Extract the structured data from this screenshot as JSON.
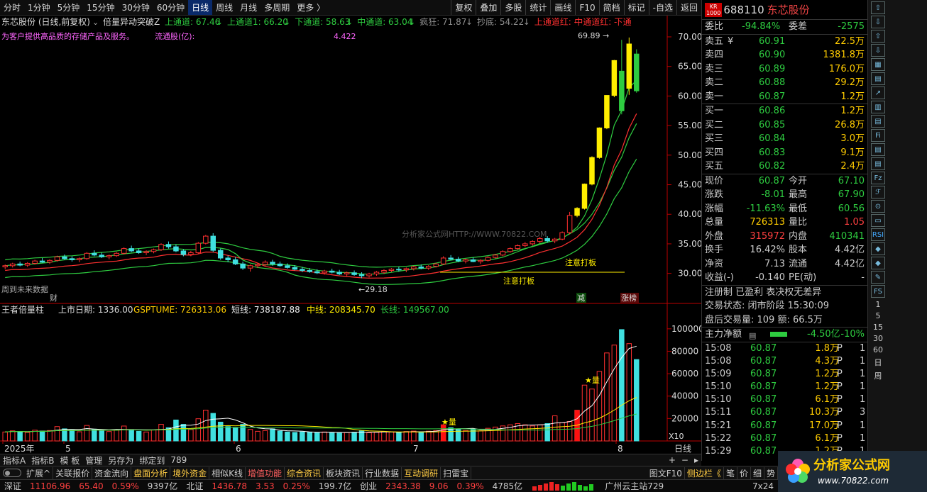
{
  "toolbar": {
    "periods": [
      "分时",
      "1分钟",
      "5分钟",
      "15分钟",
      "30分钟",
      "60分钟",
      "日线",
      "周线",
      "月线",
      "多周期",
      "更多 〉"
    ],
    "active": "日线",
    "right": [
      "复权",
      "叠加",
      "多股",
      "统计",
      "画线",
      "F10",
      "简档",
      "标记",
      "-自选",
      "返回"
    ]
  },
  "chart": {
    "stock_label": "东芯股份 (日线,前复权)",
    "indicator_label": "倍量异动突破Z",
    "indicator_values": [
      {
        "text": "上通道: 67.46",
        "arrow": "↓",
        "color": "#2ecc40"
      },
      {
        "text": "上通道1: 66.20",
        "arrow": "↓",
        "color": "#2ecc40"
      },
      {
        "text": "下通道: 58.63",
        "arrow": "↓",
        "color": "#2ecc40"
      },
      {
        "text": "中通道: 63.04",
        "arrow": "↓",
        "color": "#2ecc40"
      },
      {
        "text": "疯狂: 71.87",
        "arrow": "↓",
        "color": "#909090"
      },
      {
        "text": "抄底: 54.22",
        "arrow": "↓",
        "color": "#909090"
      },
      {
        "text": "上通道红: -",
        "arrow": "",
        "color": "#ff3030"
      },
      {
        "text": "中通道红: -",
        "arrow": "",
        "color": "#ff3030"
      },
      {
        "text": "下通",
        "arrow": "",
        "color": "#ff3030"
      }
    ],
    "business_text": "为客户提供高品质的存储产品及服务。",
    "float_share_label": "流通股(亿):",
    "float_share_value": "4.422",
    "watermark": "分析家公式网HTTP://WWW.70822.COM",
    "future_label": "周到未来数据",
    "cai_label": "财",
    "annot_warn1": "注意打板",
    "annot_warn2": "注意打板",
    "low_mark": "←29.18",
    "high_mark": "69.89 →",
    "tag_jian": "减",
    "tag_zhangbang": "涨榜",
    "vol_title": "王者倍量柱",
    "vol_listed": "上市日期: 1336.00",
    "vol_gsp": "GSPTUME: 726313.06",
    "vol_short": "短线: 738187.88",
    "vol_mid": "中线: 208345.70",
    "vol_long": "长线: 149567.00",
    "vol_star": "★量",
    "vol_x10": "X10",
    "period_label": "日线"
  },
  "chart_data": [
    {
      "type": "candlestick",
      "title": "东芯股份 (日线,前复权)",
      "y_ticks": [
        "70.00",
        "65.00",
        "60.00",
        "55.00",
        "50.00",
        "45.00",
        "40.00",
        "35.00",
        "30.00"
      ],
      "ylim": [
        28.4,
        71.2
      ],
      "x_labels": [
        "2025年",
        "5",
        "6",
        "7",
        "8"
      ],
      "ohlc": [
        [
          31.1,
          31.5,
          30.7,
          31.3
        ],
        [
          31.3,
          31.8,
          31.0,
          31.6
        ],
        [
          31.6,
          32.0,
          31.2,
          31.4
        ],
        [
          31.4,
          31.9,
          31.1,
          31.7
        ],
        [
          31.7,
          32.3,
          31.5,
          32.1
        ],
        [
          32.1,
          32.6,
          31.8,
          31.9
        ],
        [
          31.9,
          32.4,
          31.6,
          32.2
        ],
        [
          32.2,
          33.0,
          32.0,
          32.8
        ],
        [
          32.8,
          33.2,
          32.3,
          32.5
        ],
        [
          32.5,
          32.9,
          32.0,
          32.3
        ],
        [
          32.3,
          32.7,
          31.9,
          32.5
        ],
        [
          32.5,
          33.6,
          32.3,
          33.4
        ],
        [
          33.4,
          33.9,
          32.9,
          33.1
        ],
        [
          33.1,
          33.5,
          32.6,
          32.8
        ],
        [
          32.8,
          33.2,
          32.4,
          33.0
        ],
        [
          33.0,
          33.6,
          32.8,
          33.4
        ],
        [
          33.4,
          34.4,
          33.2,
          34.2
        ],
        [
          34.2,
          34.7,
          33.6,
          33.8
        ],
        [
          33.8,
          34.2,
          33.3,
          33.5
        ],
        [
          33.5,
          33.9,
          33.1,
          33.7
        ],
        [
          33.7,
          34.2,
          33.4,
          34.0
        ],
        [
          34.0,
          35.1,
          33.8,
          34.9
        ],
        [
          34.9,
          35.4,
          34.2,
          34.5
        ],
        [
          34.5,
          34.9,
          33.6,
          33.8
        ],
        [
          33.8,
          34.1,
          32.9,
          33.2
        ],
        [
          33.2,
          33.8,
          32.9,
          33.5
        ],
        [
          33.5,
          35.3,
          33.3,
          35.1
        ],
        [
          35.1,
          36.5,
          34.9,
          36.3
        ],
        [
          36.3,
          36.8,
          33.6,
          33.9
        ],
        [
          33.9,
          34.2,
          32.3,
          32.6
        ],
        [
          32.6,
          33.0,
          31.9,
          32.3
        ],
        [
          32.3,
          32.8,
          31.4,
          31.6
        ],
        [
          31.6,
          32.0,
          30.6,
          30.9
        ],
        [
          30.9,
          31.5,
          30.3,
          31.3
        ],
        [
          31.3,
          31.8,
          30.9,
          31.5
        ],
        [
          31.5,
          32.2,
          31.2,
          31.9
        ],
        [
          31.9,
          32.3,
          31.3,
          31.6
        ],
        [
          31.6,
          32.0,
          31.1,
          31.3
        ],
        [
          31.3,
          31.7,
          30.8,
          31.0
        ],
        [
          31.0,
          31.4,
          30.5,
          30.7
        ],
        [
          30.7,
          31.1,
          30.2,
          30.5
        ],
        [
          30.5,
          30.9,
          30.1,
          30.3
        ],
        [
          30.3,
          30.7,
          29.9,
          30.1
        ],
        [
          30.1,
          30.6,
          29.8,
          30.4
        ],
        [
          30.4,
          30.8,
          30.0,
          30.2
        ],
        [
          30.2,
          30.6,
          29.7,
          29.9
        ],
        [
          29.9,
          30.3,
          29.5,
          30.1
        ],
        [
          30.1,
          30.5,
          29.6,
          29.8
        ],
        [
          29.8,
          30.2,
          29.18,
          29.6
        ],
        [
          29.6,
          30.1,
          29.3,
          29.9
        ],
        [
          29.9,
          30.4,
          29.6,
          30.2
        ],
        [
          30.2,
          30.7,
          29.9,
          30.5
        ],
        [
          30.5,
          30.9,
          30.2,
          30.7
        ],
        [
          30.7,
          31.1,
          30.3,
          30.6
        ],
        [
          30.6,
          31.0,
          30.2,
          30.8
        ],
        [
          30.8,
          31.3,
          30.5,
          31.1
        ],
        [
          31.1,
          31.5,
          30.7,
          30.9
        ],
        [
          30.9,
          31.4,
          30.6,
          31.2
        ],
        [
          31.2,
          31.8,
          31.0,
          31.6
        ],
        [
          31.6,
          32.9,
          31.4,
          32.6
        ],
        [
          32.6,
          33.1,
          32.2,
          32.4
        ],
        [
          32.4,
          32.8,
          31.9,
          32.1
        ],
        [
          32.1,
          32.5,
          31.7,
          32.3
        ],
        [
          32.3,
          32.7,
          31.9,
          32.0
        ],
        [
          32.0,
          32.4,
          31.6,
          32.2
        ],
        [
          32.2,
          32.9,
          32.0,
          32.7
        ],
        [
          32.7,
          33.3,
          32.5,
          33.1
        ],
        [
          33.1,
          33.9,
          32.9,
          33.7
        ],
        [
          33.7,
          34.4,
          33.5,
          34.2
        ],
        [
          34.2,
          34.9,
          34.0,
          34.7
        ],
        [
          34.7,
          35.3,
          34.4,
          35.0
        ],
        [
          35.0,
          35.6,
          34.7,
          35.4
        ],
        [
          35.4,
          36.2,
          35.1,
          35.9
        ],
        [
          35.9,
          36.3,
          35.2,
          35.5
        ],
        [
          35.5,
          36.0,
          35.1,
          35.8
        ],
        [
          35.8,
          37.1,
          35.6,
          36.9
        ],
        [
          36.9,
          40.4,
          36.6,
          39.8
        ],
        [
          39.8,
          41.2,
          39.5,
          41.0
        ],
        [
          41.0,
          45.2,
          40.8,
          45.1
        ],
        [
          45.1,
          49.8,
          44.9,
          49.6
        ],
        [
          49.6,
          54.7,
          49.4,
          54.6
        ],
        [
          54.6,
          60.1,
          54.4,
          60.1
        ],
        [
          60.1,
          66.1,
          59.8,
          66.0
        ],
        [
          64.2,
          69.5,
          56.9,
          57.5
        ],
        [
          61.3,
          69.89,
          60.2,
          68.8
        ],
        [
          67.1,
          67.9,
          60.56,
          60.87
        ]
      ]
    },
    {
      "type": "bar",
      "title": "王者倍量柱",
      "y_ticks": [
        "100000",
        "80000",
        "60000",
        "40000",
        "20000"
      ],
      "ylim": [
        0,
        110000
      ],
      "series": [
        {
          "name": "GSPTUME",
          "values": [
            8000,
            9000,
            8500,
            7600,
            9600,
            8800,
            9300,
            12800,
            10800,
            9800,
            8200,
            13800,
            10500,
            9000,
            8400,
            9800,
            13300,
            10200,
            8600,
            8000,
            9800,
            14800,
            11800,
            18700,
            14800,
            10200,
            19800,
            27500,
            24600,
            16800,
            12800,
            11800,
            14800,
            10300,
            8600,
            9300,
            10800,
            8800,
            8000,
            7600,
            8100,
            7800,
            7400,
            8000,
            7600,
            7100,
            7500,
            7800,
            9000,
            7300,
            7700,
            8300,
            8000,
            7600,
            8400,
            8800,
            8100,
            8700,
            9200,
            14400,
            11800,
            10200,
            9300,
            10100,
            9000,
            11300,
            12400,
            13400,
            14400,
            15500,
            14400,
            13400,
            14400,
            15500,
            22400,
            16300,
            17400,
            27400,
            49800,
            46300,
            62000,
            78500,
            85500,
            99300,
            86800,
            72600
          ]
        },
        {
          "name": "短线",
          "values": []
        },
        {
          "name": "中线",
          "values": []
        },
        {
          "name": "长线",
          "values": []
        }
      ]
    }
  ],
  "quote": {
    "krbadge": [
      "KR",
      "1000"
    ],
    "code": "688110",
    "name": "东芯股份",
    "weibi_label": "委比",
    "weibi_value": "-94.84%",
    "weicha_label": "委差",
    "weicha_value": "-2575",
    "asks": [
      {
        "label": "卖五",
        "flag": "¥",
        "price": "60.91",
        "vol": "22.5万"
      },
      {
        "label": "卖四",
        "flag": "",
        "price": "60.90",
        "vol": "1381.8万"
      },
      {
        "label": "卖三",
        "flag": "",
        "price": "60.89",
        "vol": "176.0万"
      },
      {
        "label": "卖二",
        "flag": "",
        "price": "60.88",
        "vol": "29.2万"
      },
      {
        "label": "卖一",
        "flag": "",
        "price": "60.87",
        "vol": "1.2万"
      }
    ],
    "bids": [
      {
        "label": "买一",
        "price": "60.86",
        "vol": "1.2万"
      },
      {
        "label": "买二",
        "price": "60.85",
        "vol": "26.8万"
      },
      {
        "label": "买三",
        "price": "60.84",
        "vol": "3.0万"
      },
      {
        "label": "买四",
        "price": "60.83",
        "vol": "9.1万"
      },
      {
        "label": "买五",
        "price": "60.82",
        "vol": "2.4万"
      }
    ],
    "stats": [
      [
        {
          "t": "现价",
          "c": "c-w"
        },
        {
          "t": "60.87",
          "c": "c-g"
        },
        {
          "t": "今开",
          "c": "c-w"
        },
        {
          "t": "67.10",
          "c": "c-g"
        }
      ],
      [
        {
          "t": "涨跌",
          "c": "c-w"
        },
        {
          "t": "-8.01",
          "c": "c-g"
        },
        {
          "t": "最高",
          "c": "c-w"
        },
        {
          "t": "67.90",
          "c": "c-g"
        }
      ],
      [
        {
          "t": "涨幅",
          "c": "c-w"
        },
        {
          "t": "-11.63%",
          "c": "c-g"
        },
        {
          "t": "最低",
          "c": "c-w"
        },
        {
          "t": "60.56",
          "c": "c-g"
        }
      ],
      [
        {
          "t": "总量",
          "c": "c-w"
        },
        {
          "t": "726313",
          "c": "c-y"
        },
        {
          "t": "量比",
          "c": "c-w"
        },
        {
          "t": "1.05",
          "c": "c-r"
        }
      ],
      [
        {
          "t": "外盘",
          "c": "c-w"
        },
        {
          "t": "315972",
          "c": "c-r"
        },
        {
          "t": "内盘",
          "c": "c-w"
        },
        {
          "t": "410341",
          "c": "c-g"
        }
      ],
      [
        {
          "t": "换手",
          "c": "c-w"
        },
        {
          "t": "16.42%",
          "c": "c-w"
        },
        {
          "t": "股本",
          "c": "c-w"
        },
        {
          "t": "4.42亿",
          "c": "c-w"
        }
      ],
      [
        {
          "t": "净资",
          "c": "c-w"
        },
        {
          "t": "7.13",
          "c": "c-w"
        },
        {
          "t": "流通",
          "c": "c-w"
        },
        {
          "t": "4.42亿",
          "c": "c-w"
        }
      ],
      [
        {
          "t": "收益(-)",
          "c": "c-w"
        },
        {
          "t": "-0.140",
          "c": "c-w"
        },
        {
          "t": "PE(动)",
          "c": "c-w"
        },
        {
          "t": "-",
          "c": "c-w"
        }
      ]
    ],
    "reg_line": "注册制 已盈利 表决权无差异",
    "trade_state": "交易状态: 闭市阶段 15:30:09",
    "after_label": "盘后交易量: 109  额: 66.5万",
    "main_label": "主力净额",
    "main_value": "-4.50亿",
    "main_pct": "-10%",
    "ticks": [
      [
        "15:08",
        "60.87",
        "1.8万",
        "P",
        "1"
      ],
      [
        "15:08",
        "60.87",
        "4.3万",
        "P",
        "1"
      ],
      [
        "15:09",
        "60.87",
        "1.2万",
        "P",
        "1"
      ],
      [
        "15:10",
        "60.87",
        "1.2万",
        "P",
        "1"
      ],
      [
        "15:10",
        "60.87",
        "6.1万",
        "P",
        "1"
      ],
      [
        "15:11",
        "60.87",
        "10.3万",
        "P",
        "3"
      ],
      [
        "15:21",
        "60.87",
        "17.0万",
        "P",
        "1"
      ],
      [
        "15:22",
        "60.87",
        "6.1万",
        "P",
        "1"
      ],
      [
        "15:29",
        "60.87",
        "1.2万",
        "P",
        "1"
      ]
    ]
  },
  "sidebar_icons": [
    "RSI",
    "FS",
    "1",
    "5",
    "15",
    "30",
    "60",
    "日",
    "周"
  ],
  "bottom": {
    "row1": [
      "指标A",
      "指标B",
      "模 板",
      "管理",
      "另存为",
      "绑定到",
      "789"
    ],
    "row1_right": "日线",
    "row2": [
      {
        "t": "扩展^",
        "c": ""
      },
      {
        "t": "关联报价",
        "c": ""
      },
      {
        "t": "资金流向",
        "c": ""
      },
      {
        "t": "盘面分析",
        "c": "yl"
      },
      {
        "t": "境外资金",
        "c": "yl"
      },
      {
        "t": "相似K线",
        "c": ""
      },
      {
        "t": "增值功能",
        "c": "hl"
      },
      {
        "t": "综合资讯",
        "c": "yl"
      },
      {
        "t": "板块资讯",
        "c": ""
      },
      {
        "t": "行业数据",
        "c": ""
      },
      {
        "t": "互动调研",
        "c": "yl"
      },
      {
        "t": "扫雷宝",
        "c": ""
      },
      {
        "t": "图文F10",
        "c": ""
      },
      {
        "t": "侧边栏《",
        "c": "yl"
      },
      {
        "t": "笔",
        "c": ""
      },
      {
        "t": "价",
        "c": ""
      },
      {
        "t": "细",
        "c": ""
      },
      {
        "t": "势",
        "c": ""
      }
    ],
    "row3": [
      {
        "t": "深证",
        "c": "c-w"
      },
      {
        "t": "11106.96",
        "c": "c-r"
      },
      {
        "t": "65.40",
        "c": "c-r"
      },
      {
        "t": "0.59%",
        "c": "c-r"
      },
      {
        "t": "9397亿",
        "c": "c-w"
      },
      {
        "t": "北证",
        "c": "c-w"
      },
      {
        "t": "1436.78",
        "c": "c-r"
      },
      {
        "t": "3.53",
        "c": "c-r"
      },
      {
        "t": "0.25%",
        "c": "c-r"
      },
      {
        "t": "199.7亿",
        "c": "c-w"
      },
      {
        "t": "创业",
        "c": "c-w"
      },
      {
        "t": "2343.38",
        "c": "c-r"
      },
      {
        "t": "9.06",
        "c": "c-r"
      },
      {
        "t": "0.39%",
        "c": "c-r"
      },
      {
        "t": "4785亿",
        "c": "c-w"
      }
    ],
    "row3_right": "广州云主站729",
    "row3_far": "7x24"
  },
  "logo": {
    "text": "分析家公式网",
    "url": "www.70822.com"
  },
  "colors": {
    "up": "#ff3030",
    "down": "#40e0e0",
    "yellow": "#ffee00",
    "green": "#2ecc40"
  }
}
